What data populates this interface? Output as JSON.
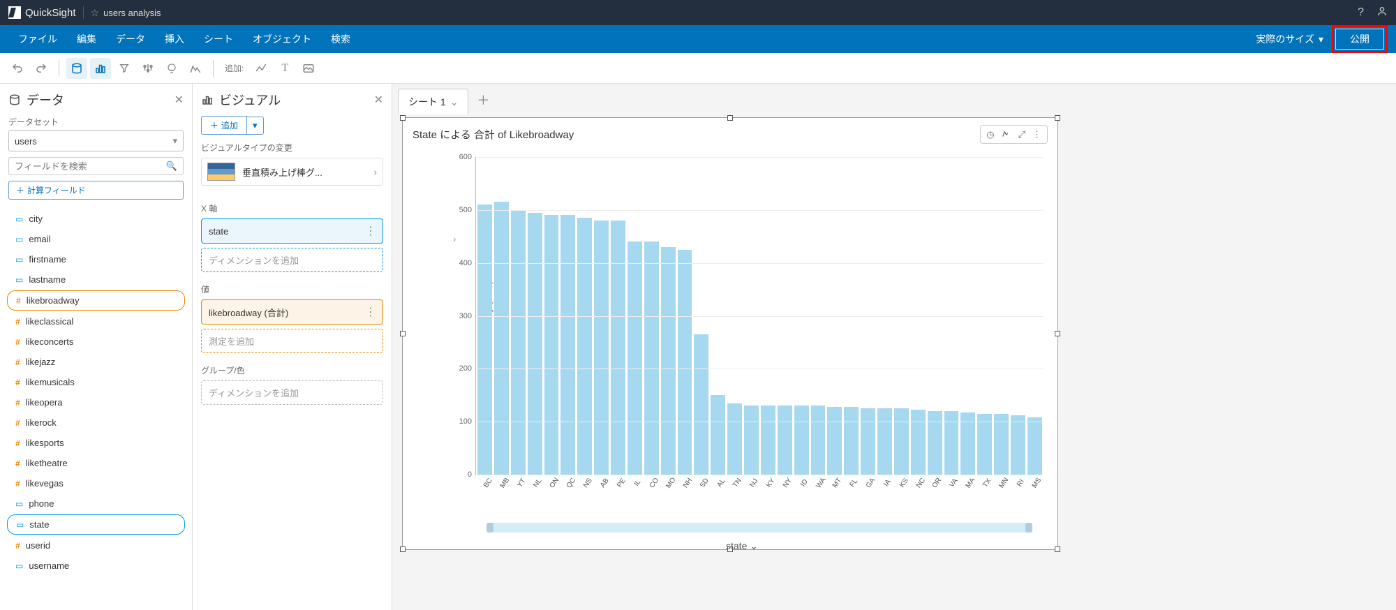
{
  "topbar": {
    "product": "QuickSight",
    "analysis_name": "users analysis"
  },
  "menus": [
    "ファイル",
    "編集",
    "データ",
    "挿入",
    "シート",
    "オブジェクト",
    "検索"
  ],
  "size_dropdown": "実際のサイズ",
  "publish_label": "公開",
  "toolbar": {
    "add_label": "追加:"
  },
  "data_panel": {
    "title": "データ",
    "dataset_label": "データセット",
    "dataset_value": "users",
    "search_placeholder": "フィールドを検索",
    "calc_field_btn": "計算フィールド",
    "fields": [
      {
        "name": "city",
        "type": "dim"
      },
      {
        "name": "email",
        "type": "dim"
      },
      {
        "name": "firstname",
        "type": "dim"
      },
      {
        "name": "lastname",
        "type": "dim"
      },
      {
        "name": "likebroadway",
        "type": "num",
        "selected": "orange"
      },
      {
        "name": "likeclassical",
        "type": "num"
      },
      {
        "name": "likeconcerts",
        "type": "num"
      },
      {
        "name": "likejazz",
        "type": "num"
      },
      {
        "name": "likemusicals",
        "type": "num"
      },
      {
        "name": "likeopera",
        "type": "num"
      },
      {
        "name": "likerock",
        "type": "num"
      },
      {
        "name": "likesports",
        "type": "num"
      },
      {
        "name": "liketheatre",
        "type": "num"
      },
      {
        "name": "likevegas",
        "type": "num"
      },
      {
        "name": "phone",
        "type": "dim"
      },
      {
        "name": "state",
        "type": "dim",
        "selected": "blue"
      },
      {
        "name": "userid",
        "type": "num"
      },
      {
        "name": "username",
        "type": "dim"
      }
    ]
  },
  "visual_panel": {
    "title": "ビジュアル",
    "add_btn": "追加",
    "change_type_label": "ビジュアルタイプの変更",
    "viz_type": "垂直積み上げ棒グ...",
    "x_axis_label": "X 軸",
    "x_axis_value": "state",
    "x_axis_placeholder": "ディメンションを追加",
    "value_label": "値",
    "value_value": "likebroadway (合計)",
    "value_placeholder": "測定を追加",
    "group_label": "グループ/色",
    "group_placeholder": "ディメンションを追加"
  },
  "sheet_tab": "シート 1",
  "viz_title": "State による 合計 of Likebroadway",
  "ylabel": "likebroadway (合計)",
  "xaxis_title": "state",
  "chart_data": {
    "type": "bar",
    "title": "State による 合計 of Likebroadway",
    "xlabel": "state",
    "ylabel": "likebroadway (合計)",
    "ylim": [
      0,
      600
    ],
    "yticks": [
      0,
      100,
      200,
      300,
      400,
      500,
      600
    ],
    "categories": [
      "BC",
      "MB",
      "YT",
      "NL",
      "ON",
      "QC",
      "NS",
      "AB",
      "PE",
      "IL",
      "CO",
      "MO",
      "NH",
      "SD",
      "AL",
      "TN",
      "NJ",
      "KY",
      "NY",
      "ID",
      "WA",
      "MT",
      "FL",
      "GA",
      "IA",
      "KS",
      "NC",
      "OR",
      "VA",
      "MA",
      "TX",
      "MN",
      "RI",
      "MS"
    ],
    "values": [
      510,
      515,
      500,
      495,
      490,
      490,
      485,
      480,
      480,
      440,
      440,
      430,
      425,
      265,
      150,
      135,
      130,
      130,
      130,
      130,
      130,
      128,
      128,
      125,
      125,
      125,
      122,
      120,
      120,
      118,
      115,
      115,
      112,
      108
    ]
  }
}
